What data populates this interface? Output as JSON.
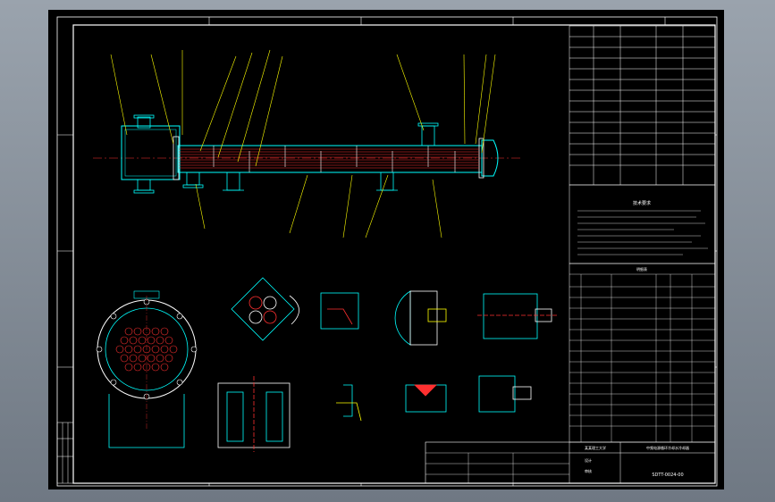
{
  "title_block": {
    "designer_unit": "某某理工大学",
    "project_title": "中频电源循环冷却水冷却器",
    "drawing_number": "SDTT-0024-00",
    "design_label": "设计",
    "check_label": "审核"
  },
  "notes_heading": "技术要求",
  "parts_list_heading": "明细表",
  "colors": {
    "background": "#000000",
    "border": "#ffffff",
    "shell": "#00ffff",
    "tubes": "#ff3030",
    "leaders": "#ffff00",
    "centerline": "#ff3030"
  }
}
